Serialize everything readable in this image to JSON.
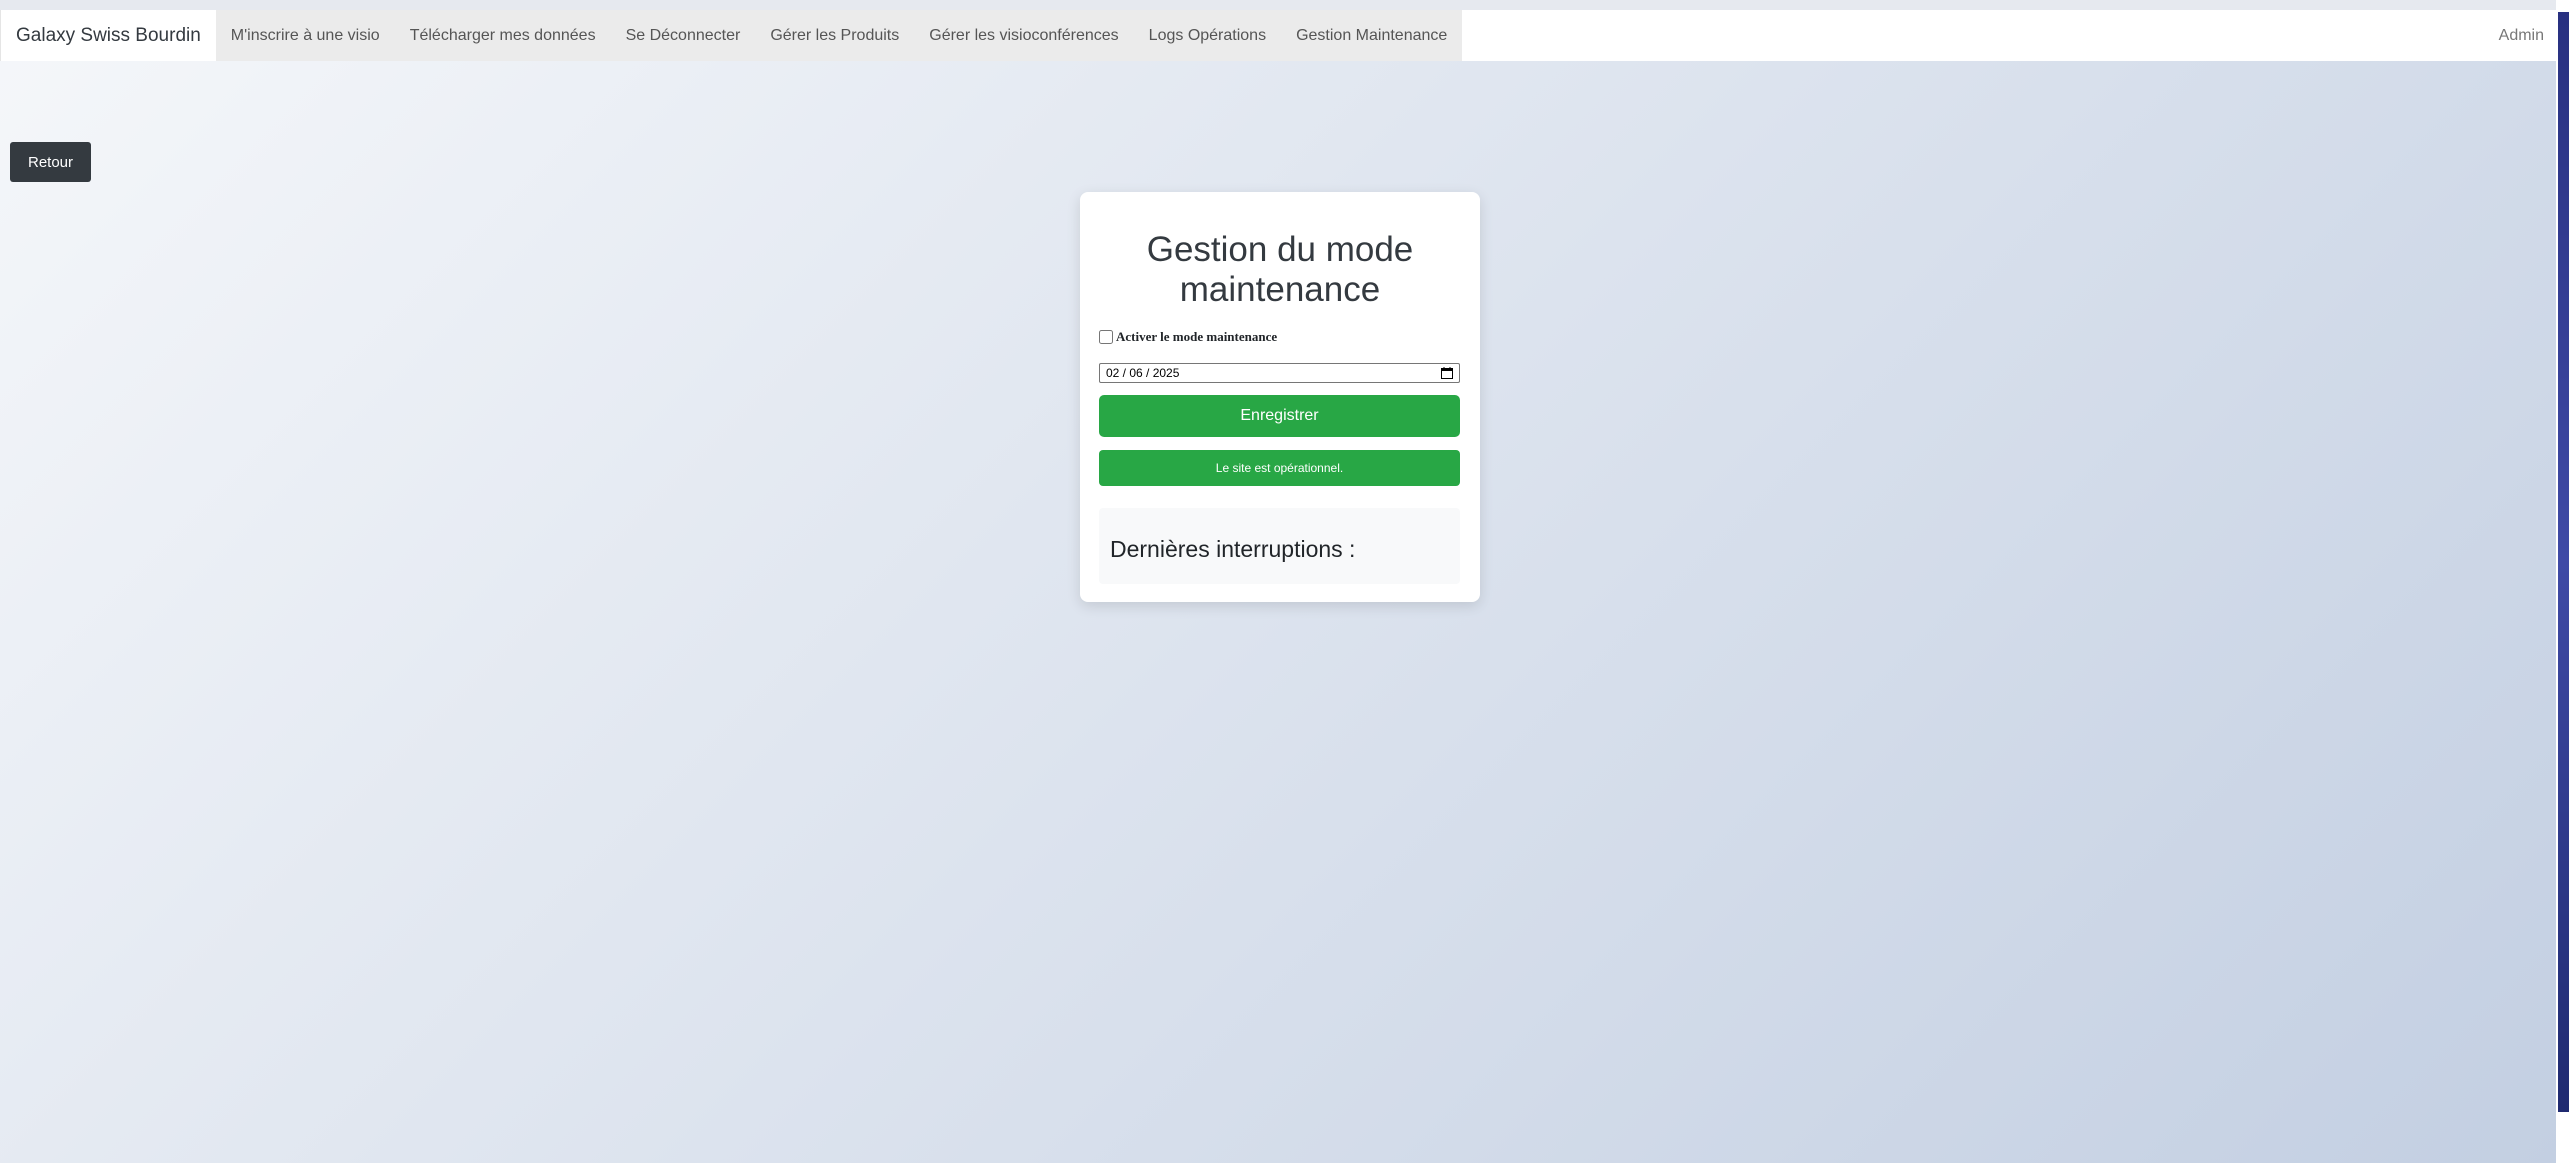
{
  "navbar": {
    "brand": "Galaxy Swiss Bourdin",
    "links": [
      "M'inscrire à une visio",
      "Télécharger mes données",
      "Se Déconnecter",
      "Gérer les Produits",
      "Gérer les visioconférences",
      "Logs Opérations",
      "Gestion Maintenance"
    ],
    "user": "Admin"
  },
  "back_label": "Retour",
  "card": {
    "title": "Gestion du mode maintenance",
    "checkbox_label": "Activer le mode maintenance",
    "checkbox_checked": false,
    "date_value": "02 / 06 / 2025",
    "save_label": "Enregistrer",
    "status_message": "Le site est opérationnel.",
    "history_title": "Dernières interruptions :"
  },
  "colors": {
    "success": "#28a745",
    "dark": "#343a40",
    "gradient_start": "#f5f7fa",
    "gradient_end": "#c3cfe2"
  },
  "icons": {
    "calendar": "calendar-icon"
  }
}
